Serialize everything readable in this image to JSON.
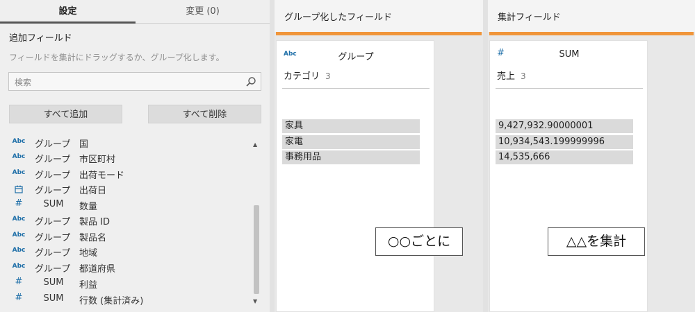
{
  "tabs": {
    "settings": "設定",
    "changes": "変更 (0)"
  },
  "add_fields": {
    "title": "追加フィールド",
    "hint": "フィールドを集計にドラッグするか、グループ化します。",
    "search_placeholder": "検索",
    "add_all_label": "すべて追加",
    "remove_all_label": "すべて削除"
  },
  "field_list": [
    {
      "type": "Abc",
      "agg": "グループ",
      "name": "国"
    },
    {
      "type": "Abc",
      "agg": "グループ",
      "name": "市区町村"
    },
    {
      "type": "Abc",
      "agg": "グループ",
      "name": "出荷モード"
    },
    {
      "type": "calendar-icon",
      "agg": "グループ",
      "name": "出荷日"
    },
    {
      "type": "#",
      "agg": "SUM",
      "name": "数量"
    },
    {
      "type": "Abc",
      "agg": "グループ",
      "name": "製品 ID"
    },
    {
      "type": "Abc",
      "agg": "グループ",
      "name": "製品名"
    },
    {
      "type": "Abc",
      "agg": "グループ",
      "name": "地域"
    },
    {
      "type": "Abc",
      "agg": "グループ",
      "name": "都道府県"
    },
    {
      "type": "#",
      "agg": "SUM",
      "name": "利益"
    },
    {
      "type": "#",
      "agg": "SUM",
      "name": "行数 (集計済み)"
    }
  ],
  "group_panel": {
    "title": "グループ化したフィールド",
    "card": {
      "type_label": "Abc",
      "agg_label": "グループ",
      "field_name": "カテゴリ",
      "count": "3",
      "values": [
        "家具",
        "家電",
        "事務用品"
      ]
    },
    "callout": "○○ごとに"
  },
  "agg_panel": {
    "title": "集計フィールド",
    "card": {
      "type_label": "#",
      "agg_label": "SUM",
      "field_name": "売上",
      "count": "3",
      "values": [
        "9,427,932.90000001",
        "10,934,543.199999996",
        "14,535,666"
      ]
    },
    "callout": "△△を集計"
  },
  "colors": {
    "accent": "#f0953a",
    "type_icon": "#1f6fa8"
  }
}
